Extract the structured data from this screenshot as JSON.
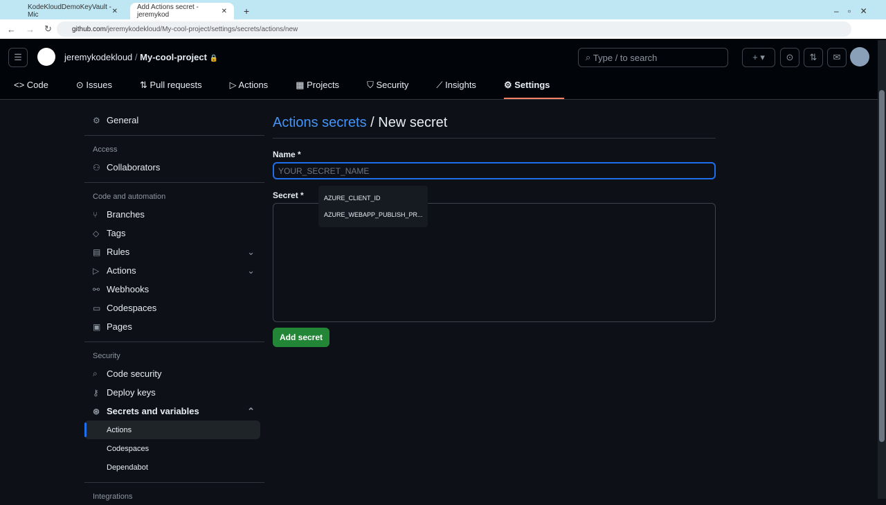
{
  "browser": {
    "tabs": [
      {
        "title": "KodeKloudDemoKeyVault - Mic"
      },
      {
        "title": "Add Actions secret - jeremykod"
      }
    ],
    "url_host": "github.com",
    "url_path": "/jeremykodekloud/My-cool-project/settings/secrets/actions/new"
  },
  "header": {
    "owner": "jeremykodekloud",
    "repo": "My-cool-project",
    "search_placeholder": "Type / to search",
    "plus": "+ ▾"
  },
  "nav": [
    {
      "label": "Code"
    },
    {
      "label": "Issues"
    },
    {
      "label": "Pull requests"
    },
    {
      "label": "Actions"
    },
    {
      "label": "Projects"
    },
    {
      "label": "Security"
    },
    {
      "label": "Insights"
    },
    {
      "label": "Settings"
    }
  ],
  "sidebar": {
    "general": "General",
    "access": "Access",
    "collaborators": "Collaborators",
    "code_automation": "Code and automation",
    "items": [
      "Branches",
      "Tags",
      "Rules",
      "Actions",
      "Webhooks",
      "Codespaces",
      "Pages"
    ],
    "security": "Security",
    "sec_items": [
      "Code security",
      "Deploy keys",
      "Secrets and variables"
    ],
    "sub": [
      "Actions",
      "Codespaces",
      "Dependabot"
    ],
    "integrations": "Integrations"
  },
  "main": {
    "breadcrumb_link": "Actions secrets",
    "title": " / New secret",
    "name_label": "Name *",
    "name_placeholder": "YOUR_SECRET_NAME",
    "secret_label": "Secret *",
    "add_button": "Add secret"
  },
  "autocomplete": [
    "AZURE_CLIENT_ID",
    "AZURE_WEBAPP_PUBLISH_PR..."
  ]
}
